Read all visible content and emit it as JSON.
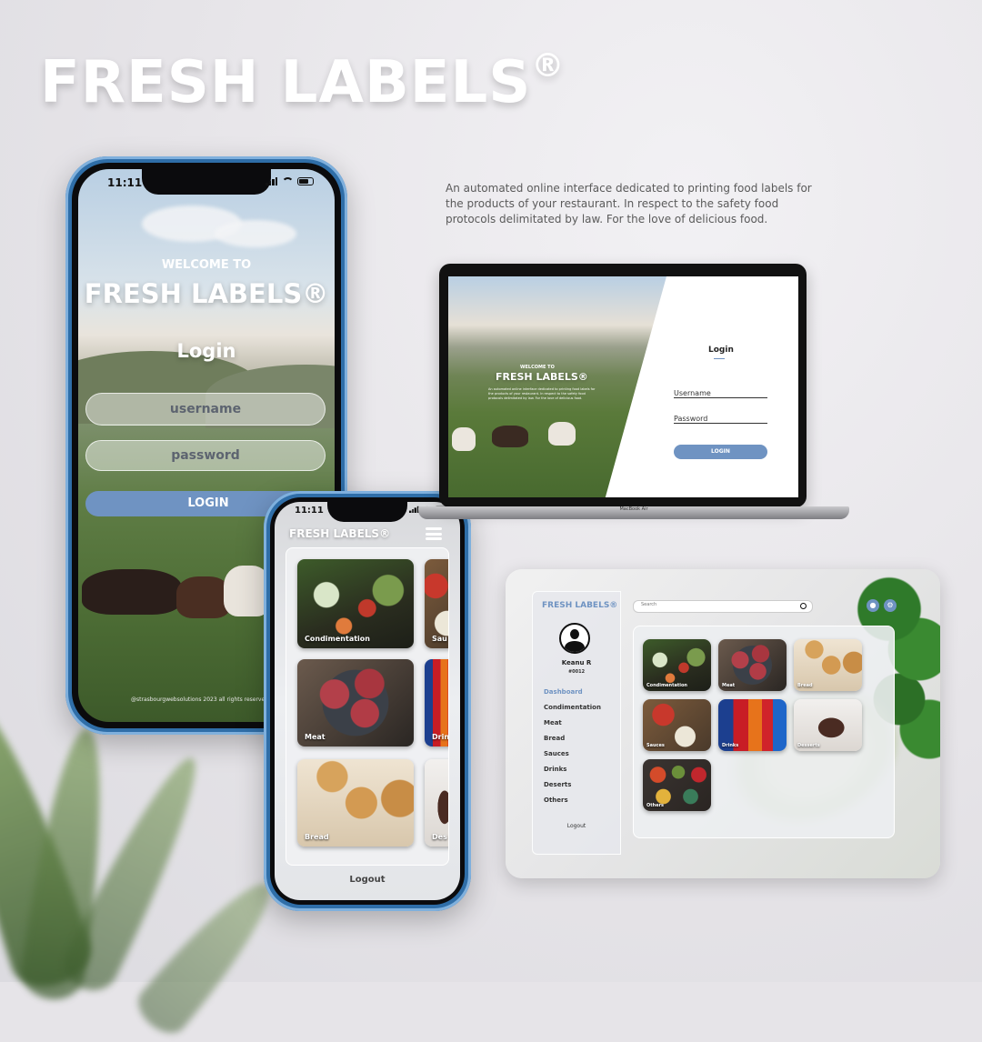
{
  "brand": {
    "title": "FRESH LABELS",
    "reg": "®",
    "tagline": "An automated online interface dedicated to printing food labels for the products of your restaurant. In respect to the safety food protocols delimitated by law. For the love of delicious food."
  },
  "phone_login": {
    "status_time": "11:11",
    "welcome": "WELCOME TO",
    "app_name": "FRESH LABELS®",
    "heading": "Login",
    "username_placeholder": "username",
    "password_placeholder": "password",
    "login_button": "LOGIN",
    "footer": "@strasbourgwebsolutions 2023 all rights reserved"
  },
  "phone_menu": {
    "status_time": "11:11",
    "app_name": "FRESH LABELS®",
    "tiles": [
      {
        "label": "Condimentation",
        "image": "condimentation"
      },
      {
        "label": "Sau",
        "image": "sauces"
      },
      {
        "label": "Meat",
        "image": "meat"
      },
      {
        "label": "Drin",
        "image": "drinks"
      },
      {
        "label": "Bread",
        "image": "bread"
      },
      {
        "label": "Des",
        "image": "desserts"
      }
    ],
    "logout": "Logout"
  },
  "laptop": {
    "welcome": "WELCOME TO",
    "app_name": "FRESH LABELS®",
    "blurb": "An automated online interface dedicated to printing food labels for the products of your restaurant. In respect to the safety food protocols delimitated by law. For the love of delicious food.",
    "heading": "Login",
    "username_label": "Username",
    "password_label": "Password",
    "login_button": "LOGIN",
    "model": "MacBook Air"
  },
  "dashboard": {
    "app_name": "FRESH LABELS®",
    "search_placeholder": "Search",
    "user_name": "Keanu R",
    "user_id": "#0012",
    "nav": [
      "Dashboard",
      "Condimentation",
      "Meat",
      "Bread",
      "Sauces",
      "Drinks",
      "Deserts",
      "Others"
    ],
    "active_nav": "Dashboard",
    "logout": "Logout",
    "tiles": [
      {
        "label": "Condimentation",
        "image": "condimentation"
      },
      {
        "label": "Meat",
        "image": "meat"
      },
      {
        "label": "Bread",
        "image": "bread"
      },
      {
        "label": "Sauces",
        "image": "sauces"
      },
      {
        "label": "Drinks",
        "image": "drinks"
      },
      {
        "label": "Desserts",
        "image": "desserts"
      },
      {
        "label": "Others",
        "image": "others"
      }
    ],
    "icons": [
      "users-icon",
      "settings-icon",
      "search-icon",
      "avatar-icon"
    ]
  },
  "colors": {
    "accent": "#6f93c2",
    "phone_frame": "#2f6ea8",
    "background": "#e6e4e8"
  }
}
